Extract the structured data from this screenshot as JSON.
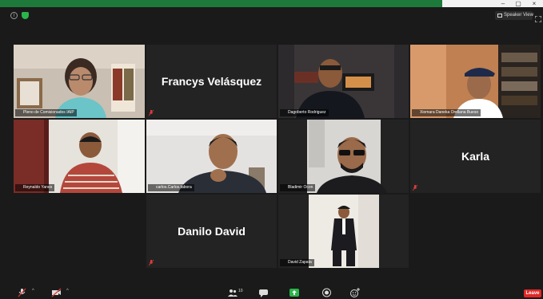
{
  "window": {
    "minimize_glyph": "–",
    "maximize_glyph": "▢",
    "close_glyph": "×"
  },
  "header": {
    "speaker_view_label": "Speaker View"
  },
  "participants": {
    "p1": "Pleno de Comisionados IAIP",
    "p2": "Francys Velásquez",
    "p3": "Dagoberto Rodriguez",
    "p4": "Xiomara Daneka Orellana Bueso",
    "p5": "Reynaldo Yanes",
    "p6": "carlos.Carlos.tabora",
    "p7": "Bladimir Ocon",
    "p8": "Karla",
    "p9": "Danilo David",
    "p10": "David Zapata"
  },
  "toolbar": {
    "participants_count": "10",
    "leave_label": "Leave",
    "caret": "^"
  },
  "colors": {
    "active_speaker_border": "#c8e04d",
    "muted_mic": "#e03a3a",
    "leave": "#e02828",
    "share": "#2bb44a"
  },
  "icons": [
    "info-icon",
    "shield-icon",
    "fullscreen-icon",
    "muted-mic-icon",
    "video-off-icon",
    "participants-icon",
    "chat-icon",
    "share-screen-icon",
    "record-icon",
    "reactions-icon"
  ]
}
